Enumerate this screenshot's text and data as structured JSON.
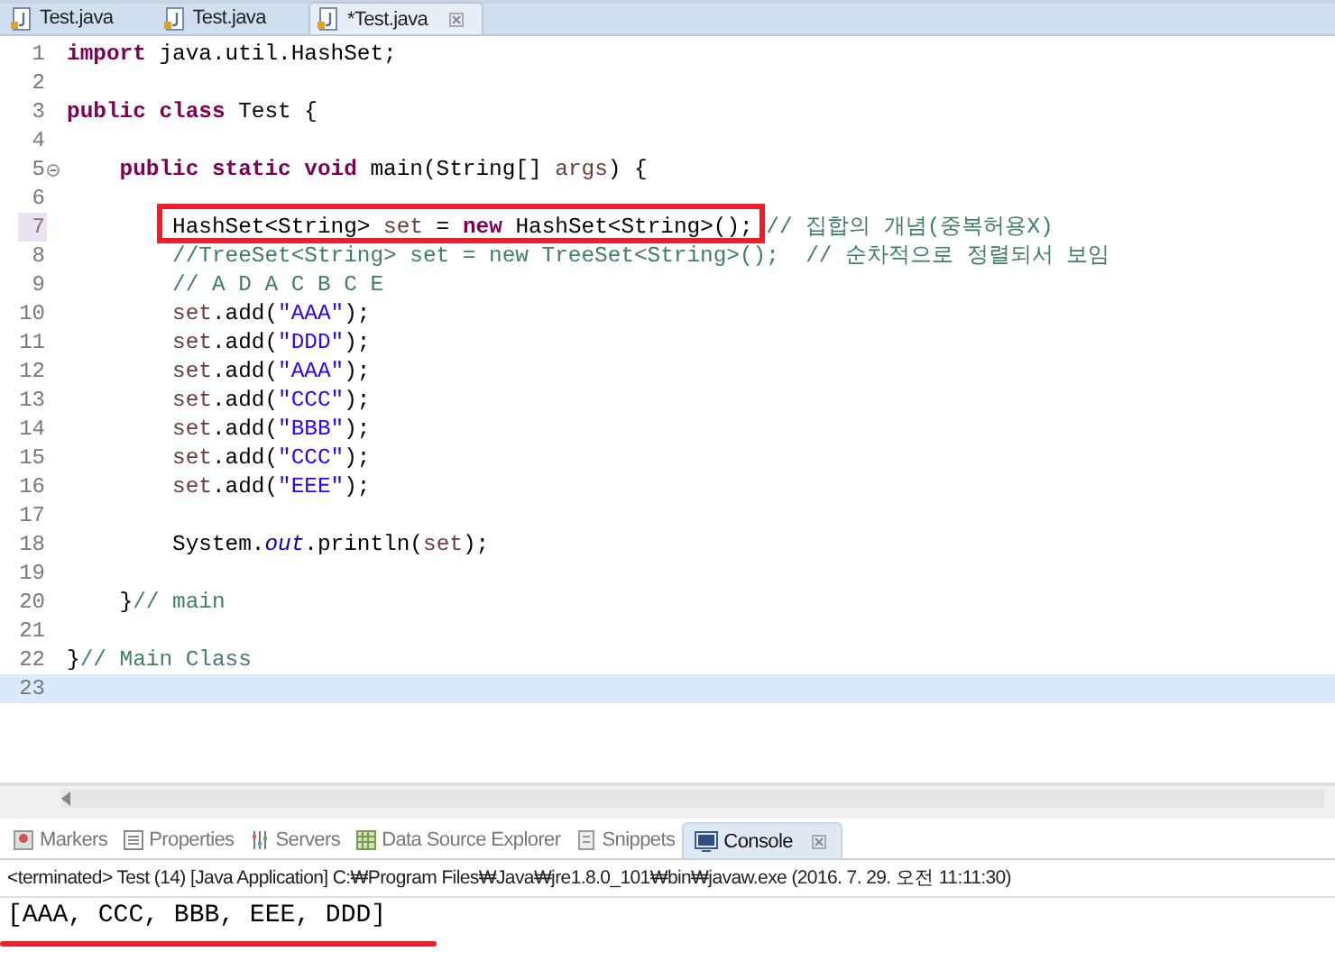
{
  "editor_tabs": [
    {
      "label": "Test.java",
      "selected": false,
      "closable": false
    },
    {
      "label": "Test.java",
      "selected": false,
      "closable": false
    },
    {
      "label": "*Test.java",
      "selected": true,
      "closable": true
    }
  ],
  "lines": [
    {
      "no": "1",
      "current": false,
      "marked": false,
      "fold": false,
      "boxed": false,
      "tokens": [
        {
          "kind": "kw",
          "text": "import"
        },
        {
          "kind": "txt",
          "text": " java.util.HashSet;"
        }
      ]
    },
    {
      "no": "2",
      "current": false,
      "marked": false,
      "fold": false,
      "boxed": false
    },
    {
      "no": "3",
      "current": false,
      "marked": false,
      "fold": false,
      "boxed": false,
      "tokens": [
        {
          "kind": "kw",
          "text": "public class"
        },
        {
          "kind": "txt",
          "text": " Test {"
        }
      ]
    },
    {
      "no": "4",
      "current": false,
      "marked": false,
      "fold": false,
      "boxed": false
    },
    {
      "no": "5",
      "current": false,
      "marked": false,
      "fold": true,
      "boxed": false,
      "tokens": [
        {
          "kind": "kw",
          "text": "    public static void"
        },
        {
          "kind": "txt",
          "text": " main(String[] "
        },
        {
          "kind": "var",
          "text": "args"
        },
        {
          "kind": "txt",
          "text": ") {"
        }
      ]
    },
    {
      "no": "6",
      "current": false,
      "marked": false,
      "fold": false,
      "boxed": false
    },
    {
      "no": "7",
      "current": false,
      "marked": true,
      "fold": false,
      "boxed": true,
      "tokens": [
        {
          "kind": "txt",
          "text": "        HashSet<String> "
        },
        {
          "kind": "var",
          "text": "set"
        },
        {
          "kind": "txt",
          "text": " = "
        },
        {
          "kind": "kw",
          "text": "new"
        },
        {
          "kind": "txt",
          "text": " HashSet<String>(); "
        },
        {
          "kind": "cmt",
          "text": "// 집합의 개념(중복허용X)"
        }
      ]
    },
    {
      "no": "8",
      "current": false,
      "marked": false,
      "fold": false,
      "boxed": false,
      "tokens": [
        {
          "kind": "cmt",
          "text": "        //TreeSet<String> set = new TreeSet<String>();  // 순차적으로 정렬되서 보임"
        }
      ]
    },
    {
      "no": "9",
      "current": false,
      "marked": false,
      "fold": false,
      "boxed": false,
      "tokens": [
        {
          "kind": "cmt",
          "text": "        // A D A C B C E"
        }
      ]
    },
    {
      "no": "10",
      "current": false,
      "marked": false,
      "fold": false,
      "boxed": false,
      "tokens": [
        {
          "kind": "var",
          "text": "        set"
        },
        {
          "kind": "txt",
          "text": ".add("
        },
        {
          "kind": "str",
          "text": "\"AAA\""
        },
        {
          "kind": "txt",
          "text": ");"
        }
      ]
    },
    {
      "no": "11",
      "current": false,
      "marked": false,
      "fold": false,
      "boxed": false,
      "tokens": [
        {
          "kind": "var",
          "text": "        set"
        },
        {
          "kind": "txt",
          "text": ".add("
        },
        {
          "kind": "str",
          "text": "\"DDD\""
        },
        {
          "kind": "txt",
          "text": ");"
        }
      ]
    },
    {
      "no": "12",
      "current": false,
      "marked": false,
      "fold": false,
      "boxed": false,
      "tokens": [
        {
          "kind": "var",
          "text": "        set"
        },
        {
          "kind": "txt",
          "text": ".add("
        },
        {
          "kind": "str",
          "text": "\"AAA\""
        },
        {
          "kind": "txt",
          "text": ");"
        }
      ]
    },
    {
      "no": "13",
      "current": false,
      "marked": false,
      "fold": false,
      "boxed": false,
      "tokens": [
        {
          "kind": "var",
          "text": "        set"
        },
        {
          "kind": "txt",
          "text": ".add("
        },
        {
          "kind": "str",
          "text": "\"CCC\""
        },
        {
          "kind": "txt",
          "text": ");"
        }
      ]
    },
    {
      "no": "14",
      "current": false,
      "marked": false,
      "fold": false,
      "boxed": false,
      "tokens": [
        {
          "kind": "var",
          "text": "        set"
        },
        {
          "kind": "txt",
          "text": ".add("
        },
        {
          "kind": "str",
          "text": "\"BBB\""
        },
        {
          "kind": "txt",
          "text": ");"
        }
      ]
    },
    {
      "no": "15",
      "current": false,
      "marked": false,
      "fold": false,
      "boxed": false,
      "tokens": [
        {
          "kind": "var",
          "text": "        set"
        },
        {
          "kind": "txt",
          "text": ".add("
        },
        {
          "kind": "str",
          "text": "\"CCC\""
        },
        {
          "kind": "txt",
          "text": ");"
        }
      ]
    },
    {
      "no": "16",
      "current": false,
      "marked": false,
      "fold": false,
      "boxed": false,
      "tokens": [
        {
          "kind": "var",
          "text": "        set"
        },
        {
          "kind": "txt",
          "text": ".add("
        },
        {
          "kind": "str",
          "text": "\"EEE\""
        },
        {
          "kind": "txt",
          "text": ");"
        }
      ]
    },
    {
      "no": "17",
      "current": false,
      "marked": false,
      "fold": false,
      "boxed": false
    },
    {
      "no": "18",
      "current": false,
      "marked": false,
      "fold": false,
      "boxed": false,
      "tokens": [
        {
          "kind": "txt",
          "text": "        System."
        },
        {
          "kind": "field",
          "text": "out"
        },
        {
          "kind": "txt",
          "text": ".println("
        },
        {
          "kind": "var",
          "text": "set"
        },
        {
          "kind": "txt",
          "text": ");"
        }
      ]
    },
    {
      "no": "19",
      "current": false,
      "marked": false,
      "fold": false,
      "boxed": false
    },
    {
      "no": "20",
      "current": false,
      "marked": false,
      "fold": false,
      "boxed": false,
      "tokens": [
        {
          "kind": "txt",
          "text": "    }"
        },
        {
          "kind": "cmt",
          "text": "// main"
        }
      ]
    },
    {
      "no": "21",
      "current": false,
      "marked": false,
      "fold": false,
      "boxed": false
    },
    {
      "no": "22",
      "current": false,
      "marked": false,
      "fold": false,
      "boxed": false,
      "tokens": [
        {
          "kind": "txt",
          "text": "}"
        },
        {
          "kind": "cmt",
          "text": "// Main Class"
        }
      ]
    },
    {
      "no": "23",
      "current": true,
      "marked": false,
      "fold": false,
      "boxed": false
    }
  ],
  "panel_tabs": [
    {
      "label": "Markers",
      "kind": "markers",
      "selected": false
    },
    {
      "label": "Properties",
      "kind": "properties",
      "selected": false
    },
    {
      "label": "Servers",
      "kind": "servers",
      "selected": false
    },
    {
      "label": "Data Source Explorer",
      "kind": "datasource",
      "selected": false
    },
    {
      "label": "Snippets",
      "kind": "snippets",
      "selected": false
    },
    {
      "label": "Console",
      "kind": "console",
      "selected": true
    }
  ],
  "console": {
    "header": "<terminated> Test (14) [Java Application] C:₩Program Files₩Java₩jre1.8.0_101₩bin₩javaw.exe (2016. 7. 29. 오전 11:11:30)",
    "output": "[AAA, CCC, BBB, EEE, DDD]",
    "underlined": true
  }
}
